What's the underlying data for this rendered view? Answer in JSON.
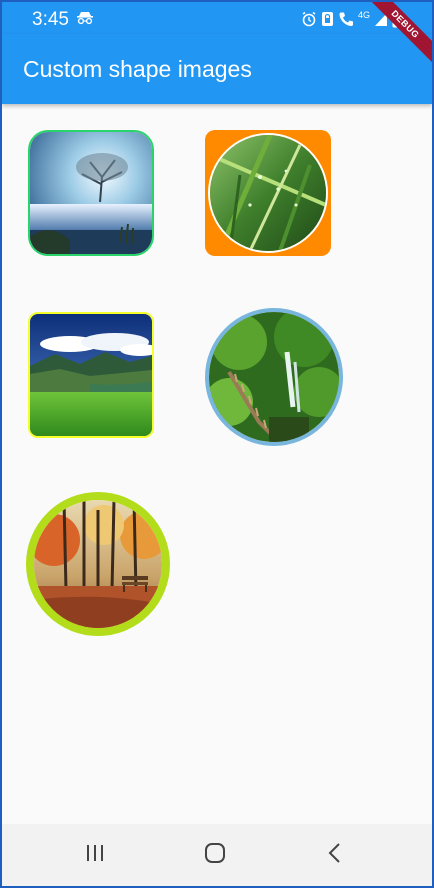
{
  "status_bar": {
    "time": "3:45",
    "icons": [
      "incognito-icon",
      "alarm-icon",
      "lock-icon",
      "call-icon",
      "network-4g-icon",
      "signal-icon",
      "battery-icon"
    ],
    "network_label": "4G"
  },
  "app_bar": {
    "title": "Custom shape images"
  },
  "debug_banner": {
    "label": "DEBUG"
  },
  "colors": {
    "primary": "#2196f3",
    "green_border": "#2ad46b",
    "orange_background": "#ff8a00",
    "yellow_border": "#f4ff2c",
    "light_blue_border": "#79b6de",
    "lime_border": "#b3dd1a"
  },
  "images": [
    {
      "shape": "rounded-rect",
      "subject": "misty tree by lake"
    },
    {
      "shape": "circle on rounded orange square",
      "subject": "grass blades with dew"
    },
    {
      "shape": "rounded-rect",
      "subject": "mountain valley landscape"
    },
    {
      "shape": "circle",
      "subject": "forest waterfall with wooden stairs"
    },
    {
      "shape": "circle",
      "subject": "autumn park with bench"
    }
  ],
  "nav_bar": {
    "icons": [
      "recent-apps-icon",
      "home-icon",
      "back-icon"
    ]
  }
}
